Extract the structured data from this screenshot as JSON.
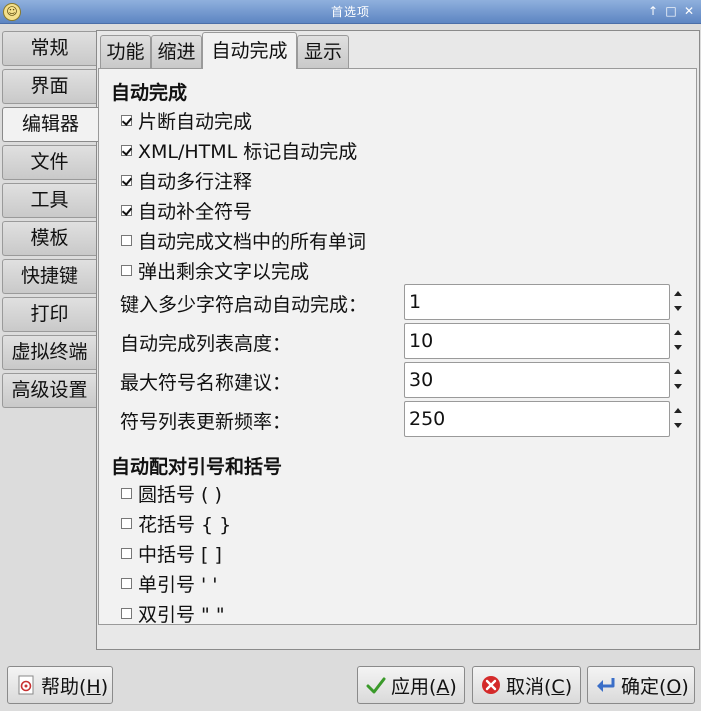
{
  "window": {
    "title": "首选项"
  },
  "side_tabs": [
    "常规",
    "界面",
    "编辑器",
    "文件",
    "工具",
    "模板",
    "快捷键",
    "打印",
    "虚拟终端",
    "高级设置"
  ],
  "top_tabs": [
    "功能",
    "缩进",
    "自动完成",
    "显示"
  ],
  "autocomplete": {
    "heading": "自动完成",
    "options": [
      {
        "label": "片断自动完成",
        "checked": true
      },
      {
        "label": "XML/HTML 标记自动完成",
        "checked": true
      },
      {
        "label": "自动多行注释",
        "checked": true
      },
      {
        "label": "自动补全符号",
        "checked": true
      },
      {
        "label": "自动完成文档中的所有单词",
        "checked": false
      },
      {
        "label": "弹出剩余文字以完成",
        "checked": false
      }
    ],
    "spin_fields": [
      {
        "label": "键入多少字符启动自动完成：",
        "value": "1"
      },
      {
        "label": "自动完成列表高度：",
        "value": "10"
      },
      {
        "label": "最大符号名称建议：",
        "value": "30"
      },
      {
        "label": "符号列表更新频率：",
        "value": "250"
      }
    ]
  },
  "autoclose": {
    "heading": "自动配对引号和括号",
    "options": [
      {
        "label": "圆括号 ( )",
        "checked": false
      },
      {
        "label": "花括号 { }",
        "checked": false
      },
      {
        "label": "中括号 [ ]",
        "checked": false
      },
      {
        "label": "单引号 ' '",
        "checked": false
      },
      {
        "label": "双引号 \" \"",
        "checked": false
      }
    ]
  },
  "buttons": {
    "help": {
      "text": "帮助(",
      "mnemonic": "H",
      "close": ")"
    },
    "apply": {
      "text": "应用(",
      "mnemonic": "A",
      "close": ")"
    },
    "cancel": {
      "text": "取消(",
      "mnemonic": "C",
      "close": ")"
    },
    "ok": {
      "text": "确定(",
      "mnemonic": "O",
      "close": ")"
    }
  },
  "icons": {
    "app": "app-icon",
    "help": "help-icon",
    "apply": "checkmark-icon",
    "cancel": "cancel-icon",
    "ok": "ok-return-icon"
  },
  "colors": {
    "titlebar": "#5d85c2",
    "apply_check": "#3a9a2a",
    "cancel_red": "#d42a2a",
    "ok_blue": "#3a6ec8"
  }
}
